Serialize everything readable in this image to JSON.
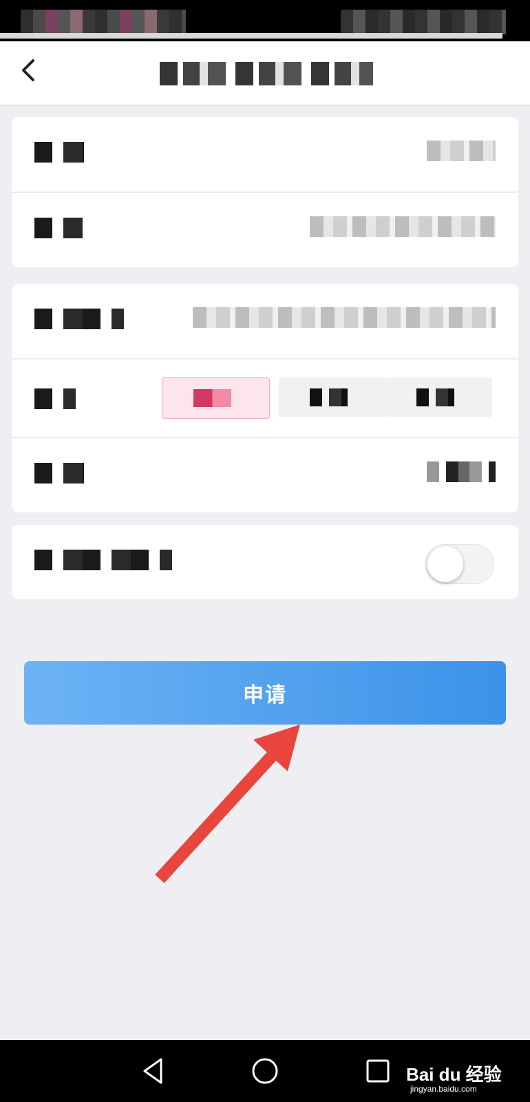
{
  "status_bar": {
    "left_text": "",
    "right_text": ""
  },
  "nav": {
    "title": "",
    "back_icon": "chevron-left-icon"
  },
  "form": {
    "cards": [
      {
        "rows": [
          {
            "label": "",
            "value": ""
          },
          {
            "label": "",
            "value": ""
          }
        ]
      },
      {
        "rows": [
          {
            "label": "",
            "value": ""
          },
          {
            "label": "",
            "options": [
              "",
              "",
              ""
            ],
            "selected_index": 0
          },
          {
            "label": "",
            "value": ""
          }
        ]
      },
      {
        "rows": [
          {
            "label": "",
            "toggle": false
          }
        ]
      }
    ]
  },
  "apply_button": {
    "label": "申请"
  },
  "colors": {
    "button_start": "#6db3f5",
    "button_end": "#3b92e8",
    "arrow": "#e8453c",
    "chip_selected": "#d33a63"
  },
  "system_nav": {
    "icons": [
      "back-triangle-icon",
      "home-circle-icon",
      "recents-square-icon"
    ]
  },
  "watermark": {
    "brand": "Bai du 经验",
    "url": "jingyan.baidu.com"
  }
}
